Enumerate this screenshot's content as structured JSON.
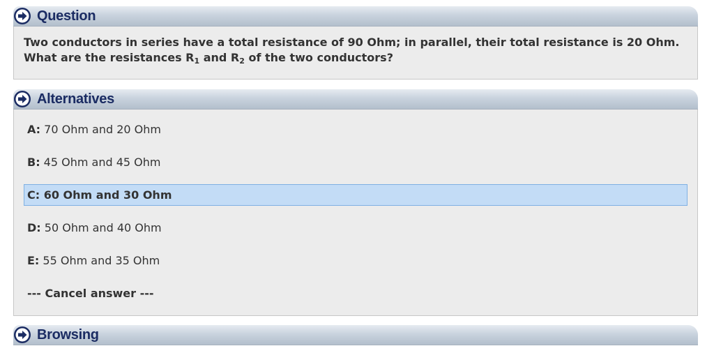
{
  "question": {
    "title": "Question",
    "text_part1": "Two conductors in series have a total resistance of 90 Ohm; in parallel, their total resistance is 20 Ohm. What are the resistances R",
    "sub1": "1",
    "text_part2": " and R",
    "sub2": "2",
    "text_part3": " of the two conductors?"
  },
  "alternatives": {
    "title": "Alternatives",
    "items": [
      {
        "letter": "A:",
        "text": " 70 Ohm and 20 Ohm"
      },
      {
        "letter": "B:",
        "text": " 45 Ohm and 45 Ohm"
      },
      {
        "letter": "C:",
        "text": " 60 Ohm and 30 Ohm"
      },
      {
        "letter": "D:",
        "text": " 50 Ohm and 40 Ohm"
      },
      {
        "letter": "E:",
        "text": " 55 Ohm and 35 Ohm"
      }
    ],
    "cancel_label": "--- Cancel answer ---"
  },
  "browsing": {
    "title": "Browsing"
  },
  "icons": {
    "header_icon": "arrow-right-circle-icon"
  },
  "colors": {
    "title": "#1b2c63",
    "selected_bg": "#c3dcf6",
    "selected_border": "#7fb0e3"
  }
}
